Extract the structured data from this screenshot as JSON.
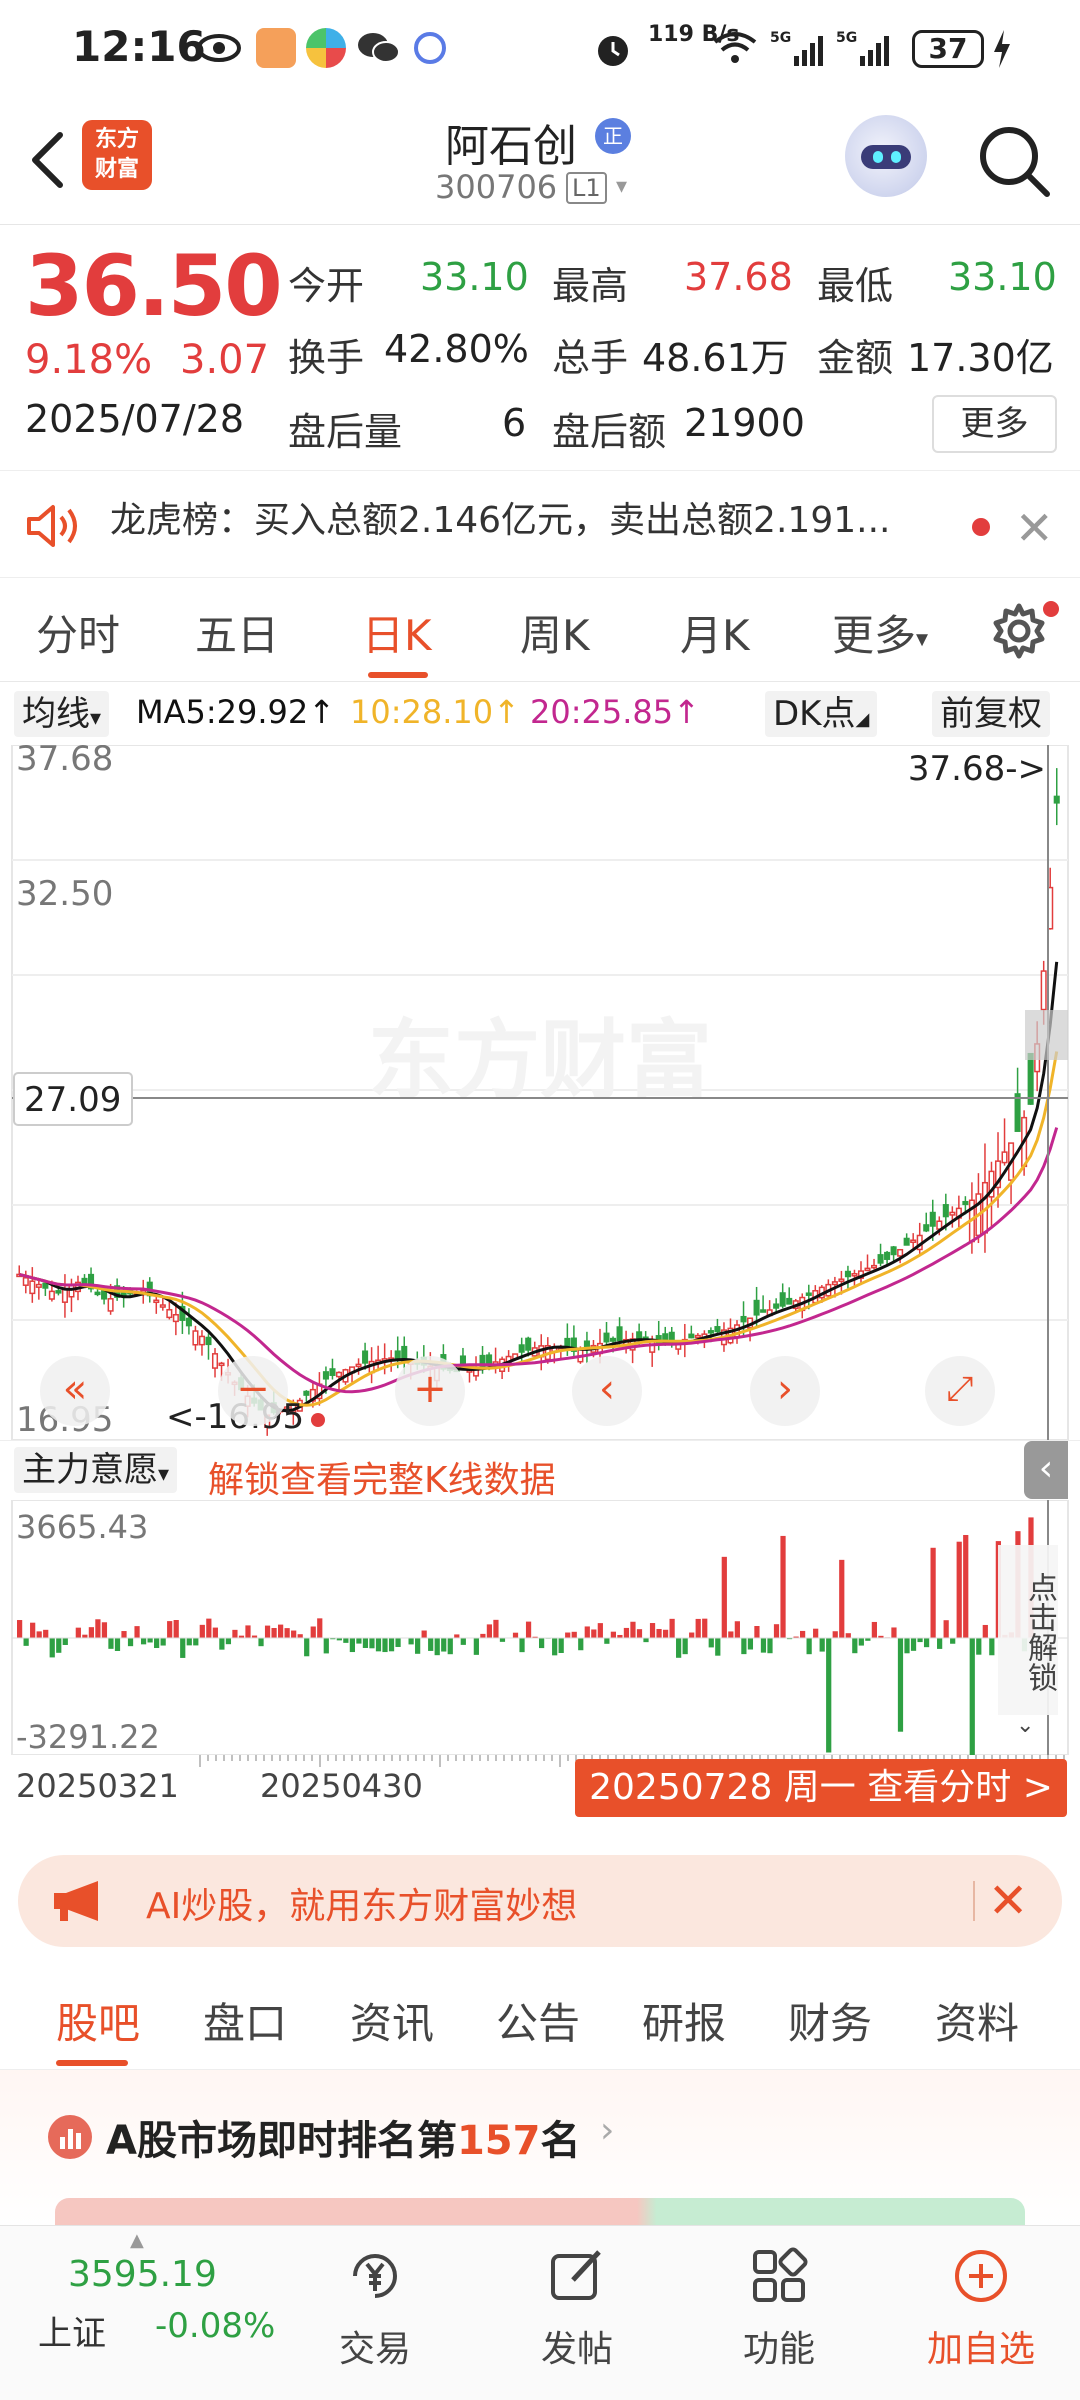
{
  "status_bar": {
    "time": "12:16",
    "net_speed": "119 B/s",
    "battery": "37"
  },
  "header": {
    "logo_text": "东方\n财富",
    "stock_name": "阿石创",
    "badge": "正",
    "stock_code": "300706",
    "level": "L1"
  },
  "quote": {
    "price": "36.50",
    "change_pct": "9.18%",
    "change": "3.07",
    "date": "2025/07/28",
    "open_label": "今开",
    "open": "33.10",
    "high_label": "最高",
    "high": "37.68",
    "low_label": "最低",
    "low": "33.10",
    "turnover_label": "换手",
    "turnover": "42.80%",
    "volume_label": "总手",
    "volume": "48.61万",
    "amount_label": "金额",
    "amount": "17.30亿",
    "after_vol_label": "盘后量",
    "after_vol": "6",
    "after_amt_label": "盘后额",
    "after_amt": "21900",
    "more": "更多"
  },
  "notice": {
    "text": "龙虎榜：买入总额2.146亿元，卖出总额2.191..."
  },
  "tabs": [
    "分时",
    "五日",
    "日K",
    "周K",
    "月K",
    "更多"
  ],
  "active_tab": "日K",
  "ma_row": {
    "avg_label": "均线",
    "ma5": "MA5:29.92↑",
    "ma10": "10:28.10↑",
    "ma20": "20:25.85↑",
    "dk": "DK点",
    "adjust": "前复权",
    "colors": {
      "ma5": "#111111",
      "ma10": "#f0b429",
      "ma20": "#c2278f"
    }
  },
  "chart_data": {
    "type": "candlestick",
    "y_labels": [
      "37.68",
      "32.50",
      "27.09",
      "16.95"
    ],
    "crosshair_value": "27.09",
    "max_marker": "37.68->",
    "min_marker": "<-16.95",
    "ylim": [
      16.95,
      37.68
    ],
    "watermark": "东方财富",
    "colors": {
      "up": "#e23d3d",
      "down": "#2ea043"
    }
  },
  "sub_chart": {
    "indicator": "主力意愿",
    "unlock_text": "解锁查看完整K线数据",
    "max": "3665.43",
    "min": "-3291.22",
    "side_label": "点击解锁"
  },
  "date_axis": {
    "start": "20250321",
    "mid": "20250430",
    "tag": "20250728 周一 查看分时 >"
  },
  "ai_banner": {
    "text": "AI炒股，就用东方财富妙想"
  },
  "bottom_tabs": [
    "股吧",
    "盘口",
    "资讯",
    "公告",
    "研报",
    "财务",
    "资料"
  ],
  "ranking": {
    "prefix": "A股市场即时排名第",
    "rank": "157",
    "suffix": "名"
  },
  "bottom_nav": {
    "index_value": "3595.19",
    "index_name": "上证",
    "index_pct": "-0.08%",
    "items": [
      "交易",
      "发帖",
      "功能",
      "加自选"
    ]
  }
}
